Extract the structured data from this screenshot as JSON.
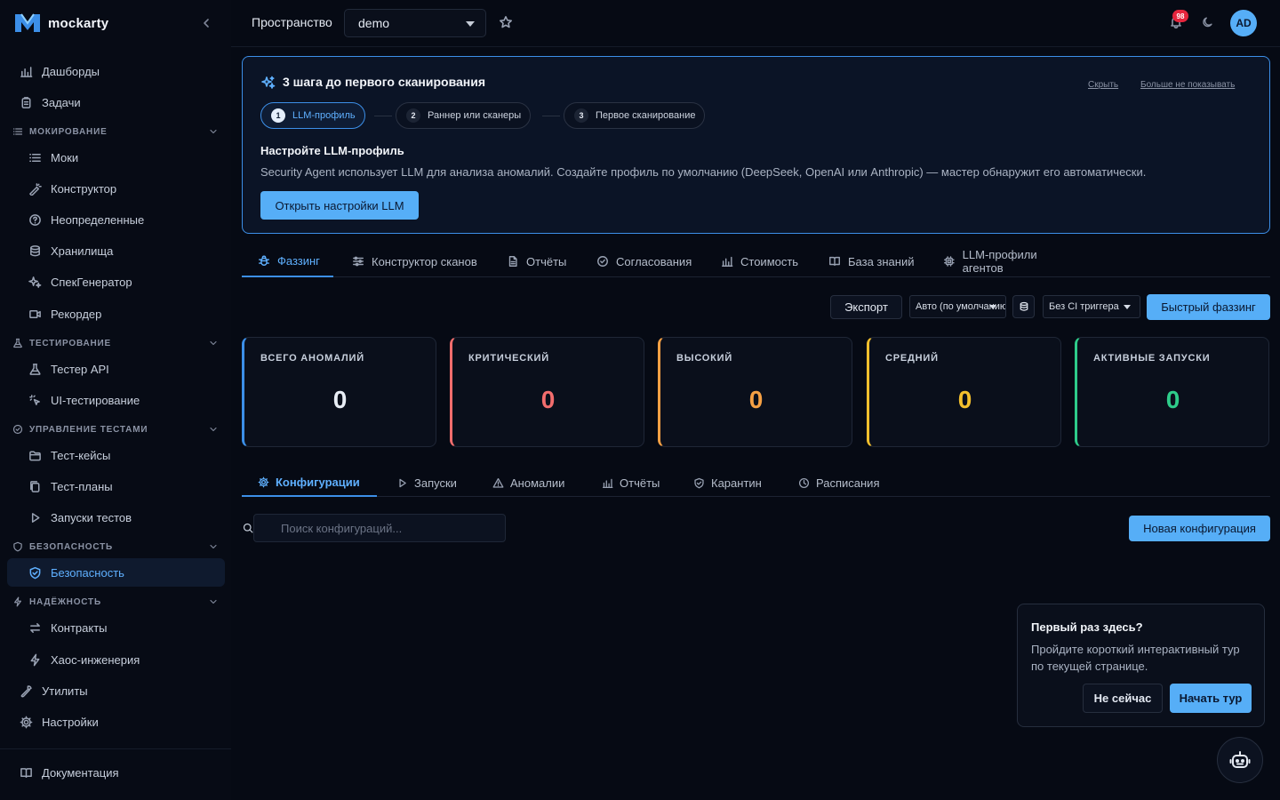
{
  "app": {
    "name": "mockarty"
  },
  "sidebar": {
    "top_items": [
      {
        "label": "Дашборды",
        "icon": "bar-chart-icon"
      },
      {
        "label": "Задачи",
        "icon": "clipboard-icon"
      }
    ],
    "sections": [
      {
        "title": "МОКИРОВАНИЕ",
        "icon": "list-icon",
        "items": [
          {
            "label": "Моки",
            "icon": "list-icon"
          },
          {
            "label": "Конструктор",
            "icon": "wand-icon"
          },
          {
            "label": "Неопределенные",
            "icon": "question-circle-icon"
          },
          {
            "label": "Хранилища",
            "icon": "database-icon"
          },
          {
            "label": "СпекГенератор",
            "icon": "sparkles-icon"
          },
          {
            "label": "Рекордер",
            "icon": "video-icon"
          }
        ]
      },
      {
        "title": "ТЕСТИРОВАНИЕ",
        "icon": "flask-icon",
        "items": [
          {
            "label": "Тестер API",
            "icon": "flask-icon"
          },
          {
            "label": "UI-тестирование",
            "icon": "cursor-click-icon"
          }
        ]
      },
      {
        "title": "УПРАВЛЕНИЕ ТЕСТАМИ",
        "icon": "check-circle-icon",
        "items": [
          {
            "label": "Тест-кейсы",
            "icon": "folder-icon"
          },
          {
            "label": "Тест-планы",
            "icon": "clipboard-copy-icon"
          },
          {
            "label": "Запуски тестов",
            "icon": "play-icon"
          }
        ]
      },
      {
        "title": "БЕЗОПАСНОСТЬ",
        "icon": "shield-icon",
        "items": [
          {
            "label": "Безопасность",
            "icon": "shield-check-icon",
            "active": true
          }
        ]
      },
      {
        "title": "НАДЁЖНОСТЬ",
        "icon": "bolt-icon",
        "items": [
          {
            "label": "Контракты",
            "icon": "arrows-swap-icon"
          },
          {
            "label": "Хаос-инженерия",
            "icon": "bolt-icon"
          }
        ]
      }
    ],
    "bottom_items": [
      {
        "label": "Утилиты",
        "icon": "wrench-icon"
      },
      {
        "label": "Настройки",
        "icon": "gear-icon"
      }
    ],
    "docs_label": "Документация"
  },
  "header": {
    "workspace_label": "Пространство",
    "workspace_value": "demo",
    "notification_count": "98",
    "avatar_initials": "AD"
  },
  "onboarding": {
    "title": "3 шага до первого сканирования",
    "hide_label": "Скрыть",
    "dont_show_label": "Больше не показывать",
    "steps": [
      {
        "num": "1",
        "label": "LLM-профиль",
        "active": true
      },
      {
        "num": "2",
        "label": "Раннер или сканеры"
      },
      {
        "num": "3",
        "label": "Первое сканирование"
      }
    ],
    "heading": "Настройте LLM-профиль",
    "description": "Security Agent использует LLM для анализа аномалий. Создайте профиль по умолчанию (DeepSeek, OpenAI или Anthropic) — мастер обнаружит его автоматически.",
    "button_label": "Открыть настройки LLM"
  },
  "main_tabs": [
    {
      "label": "Фаззинг",
      "icon": "bug-icon",
      "active": true
    },
    {
      "label": "Конструктор сканов",
      "icon": "sliders-icon"
    },
    {
      "label": "Отчёты",
      "icon": "file-icon"
    },
    {
      "label": "Согласования",
      "icon": "check-circle-icon"
    },
    {
      "label": "Стоимость",
      "icon": "bar-chart-icon"
    },
    {
      "label": "База знаний",
      "icon": "book-icon"
    },
    {
      "label": "LLM-профили агентов",
      "icon": "cpu-icon"
    }
  ],
  "toolbar": {
    "export_label": "Экспорт",
    "mode_select": "Авто (по умолчанию)",
    "ci_select": "Без CI триггера",
    "quick_fuzz_label": "Быстрый фаззинг"
  },
  "stats": [
    {
      "label": "ВСЕГО АНОМАЛИЙ",
      "value": "0",
      "color": "#e8edf5",
      "border": "#3c8fe8"
    },
    {
      "label": "КРИТИЧЕСКИЙ",
      "value": "0",
      "color": "#f26d6d",
      "border": "#f26d6d"
    },
    {
      "label": "ВЫСОКИЙ",
      "value": "0",
      "color": "#f5a044",
      "border": "#f5a044"
    },
    {
      "label": "СРЕДНИЙ",
      "value": "0",
      "color": "#f4c02d",
      "border": "#f4c02d"
    },
    {
      "label": "АКТИВНЫЕ ЗАПУСКИ",
      "value": "0",
      "color": "#2ecc8a",
      "border": "#2ecc8a"
    }
  ],
  "sub_tabs": [
    {
      "label": "Конфигурации",
      "icon": "gear-icon",
      "active": true
    },
    {
      "label": "Запуски",
      "icon": "play-icon"
    },
    {
      "label": "Аномалии",
      "icon": "warning-icon"
    },
    {
      "label": "Отчёты",
      "icon": "bar-chart-icon"
    },
    {
      "label": "Карантин",
      "icon": "shield-check-icon"
    },
    {
      "label": "Расписания",
      "icon": "clock-icon"
    }
  ],
  "search": {
    "placeholder": "Поиск конфигураций..."
  },
  "new_config_label": "Новая конфигурация",
  "tour": {
    "title": "Первый раз здесь?",
    "text": "Пройдите короткий интерактивный тур по текущей странице.",
    "later_label": "Не сейчас",
    "start_label": "Начать тур"
  }
}
